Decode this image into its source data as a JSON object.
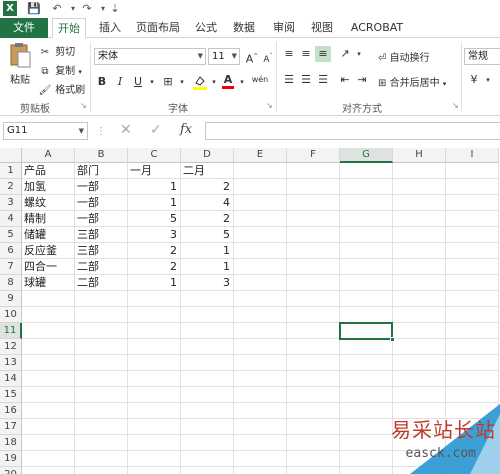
{
  "titlebar": {
    "app_icon_letter": "X",
    "save": "💾",
    "undo": "↶",
    "redo": "↷",
    "customize": "⇣"
  },
  "tabs": [
    "文件",
    "开始",
    "插入",
    "页面布局",
    "公式",
    "数据",
    "审阅",
    "视图",
    "ACROBAT"
  ],
  "ribbon": {
    "clipboard": {
      "paste": "粘贴",
      "cut": "剪切",
      "copy": "复制",
      "format_painter": "格式刷",
      "label": "剪贴板"
    },
    "font": {
      "name": "宋体",
      "size": "11",
      "grow": "A",
      "shrink": "A",
      "bold": "B",
      "italic": "I",
      "underline": "U",
      "font_color_letter": "A",
      "wen": "wén",
      "label": "字体"
    },
    "alignment": {
      "wrap_text": "自动换行",
      "merge_center": "合并后居中",
      "label": "对齐方式"
    },
    "number": {
      "format": "常规"
    }
  },
  "formula_bar": {
    "name_box": "G11",
    "cancel": "✕",
    "enter": "✓",
    "fx": "fx",
    "value": ""
  },
  "sheet": {
    "columns": [
      "A",
      "B",
      "C",
      "D",
      "E",
      "F",
      "G",
      "H",
      "I"
    ],
    "row_numbers": [
      "1",
      "2",
      "3",
      "4",
      "5",
      "6",
      "7",
      "8",
      "9",
      "10",
      "11",
      "12",
      "13",
      "14",
      "15",
      "16",
      "17",
      "18",
      "19",
      "20"
    ],
    "rows": [
      [
        "产品",
        "部门",
        "一月",
        "二月"
      ],
      [
        "加氢",
        "一部",
        "1",
        "2"
      ],
      [
        "螺纹",
        "一部",
        "1",
        "4"
      ],
      [
        "精制",
        "一部",
        "5",
        "2"
      ],
      [
        "储罐",
        "三部",
        "3",
        "5"
      ],
      [
        "反应釜",
        "三部",
        "2",
        "1"
      ],
      [
        "四合一",
        "二部",
        "2",
        "1"
      ],
      [
        "球罐",
        "二部",
        "1",
        "3"
      ]
    ],
    "selected_cell": "G11"
  },
  "watermark": {
    "text": "易采站长站",
    "sub": "easck.com"
  },
  "colors": {
    "excel_green": "#217346"
  }
}
